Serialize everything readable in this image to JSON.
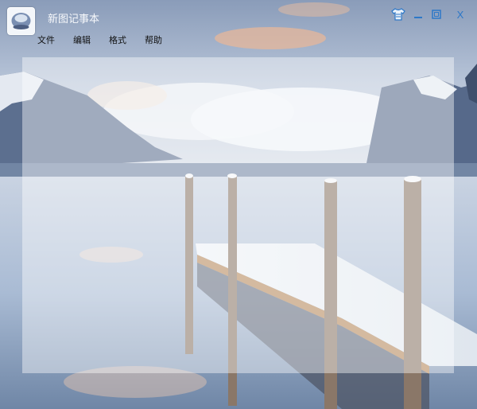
{
  "window": {
    "title": "新图记事本",
    "controls": {
      "skin_icon": "shirt-skin-icon",
      "minimize_icon": "minimize-icon",
      "maximize_icon": "maximize-icon",
      "close_label": "X"
    }
  },
  "menubar": {
    "items": [
      {
        "label": "文件"
      },
      {
        "label": "编辑"
      },
      {
        "label": "格式"
      },
      {
        "label": "帮助"
      }
    ]
  },
  "editor": {
    "value": ""
  },
  "colors": {
    "title_text": "#f6f8fb",
    "control_blue": "#2d78c8",
    "menu_text": "#111111"
  }
}
